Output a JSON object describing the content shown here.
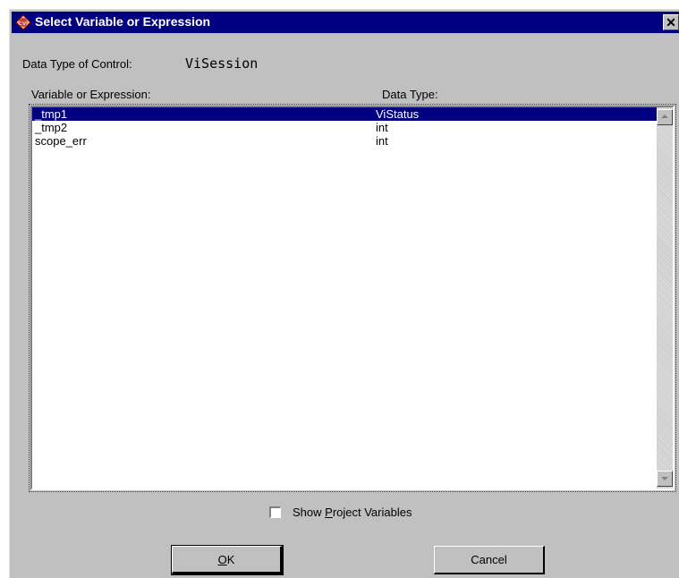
{
  "window": {
    "title": "Select Variable or Expression",
    "close_glyph": "✕",
    "icon": "cvi-app-icon"
  },
  "control": {
    "data_type_label": "Data Type of Control:",
    "data_type_value": "ViSession"
  },
  "list": {
    "column_headers": [
      "Variable or Expression:",
      "Data Type:"
    ],
    "rows": [
      {
        "name": "_tmp1",
        "type": "ViStatus",
        "selected": true
      },
      {
        "name": "_tmp2",
        "type": "int",
        "selected": false
      },
      {
        "name": "scope_err",
        "type": "int",
        "selected": false
      }
    ]
  },
  "options": {
    "show_project_variables_label": "Show Project Variables",
    "show_project_variables_checked": false
  },
  "buttons": {
    "ok": "OK",
    "cancel": "Cancel"
  },
  "colors": {
    "title_bar": "#000080",
    "selection": "#000080",
    "face": "#c0c0c0"
  }
}
